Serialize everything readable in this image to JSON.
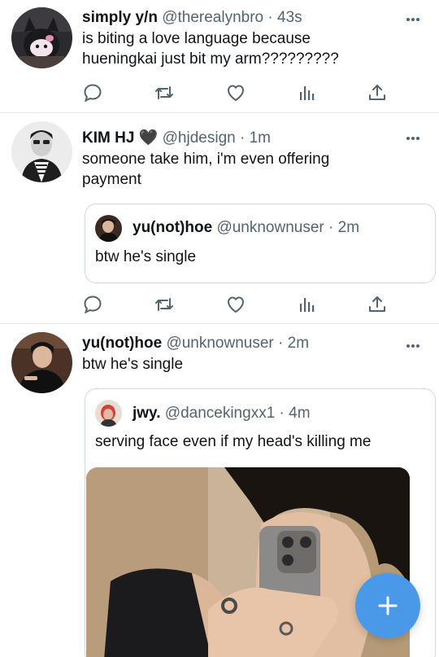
{
  "tweets": [
    {
      "name": "simply y/n",
      "handle": "@therealynbro",
      "time": "· 43s",
      "text": "is biting a love language because hueningkai just bit my arm?????????"
    },
    {
      "name": "KIM HJ",
      "name_emoji": "🖤",
      "handle": "@hjdesign",
      "time": "· 1m",
      "text": "someone take him, i'm even offering payment",
      "quote": {
        "name": "yu(not)hoe",
        "handle": "@unknownuser",
        "time": "· 2m",
        "text": "btw he's single"
      }
    },
    {
      "name": "yu(not)hoe",
      "handle": "@unknownuser",
      "time": "· 2m",
      "text": "btw he's single",
      "quote": {
        "name": "jwy.",
        "handle": "@dancekingxx1",
        "time": "· 4m",
        "text": "serving face even if my head's killing me"
      }
    }
  ],
  "icons": {
    "reply": "speech-bubble-icon",
    "retweet": "retweet-icon",
    "like": "heart-icon",
    "views": "bar-chart-icon",
    "share": "share-upload-icon",
    "more": "more-dots-icon",
    "compose": "plus-icon"
  },
  "colors": {
    "accent": "#4a99e9",
    "icon_gray": "#536471",
    "divider": "#e1e8ed"
  }
}
